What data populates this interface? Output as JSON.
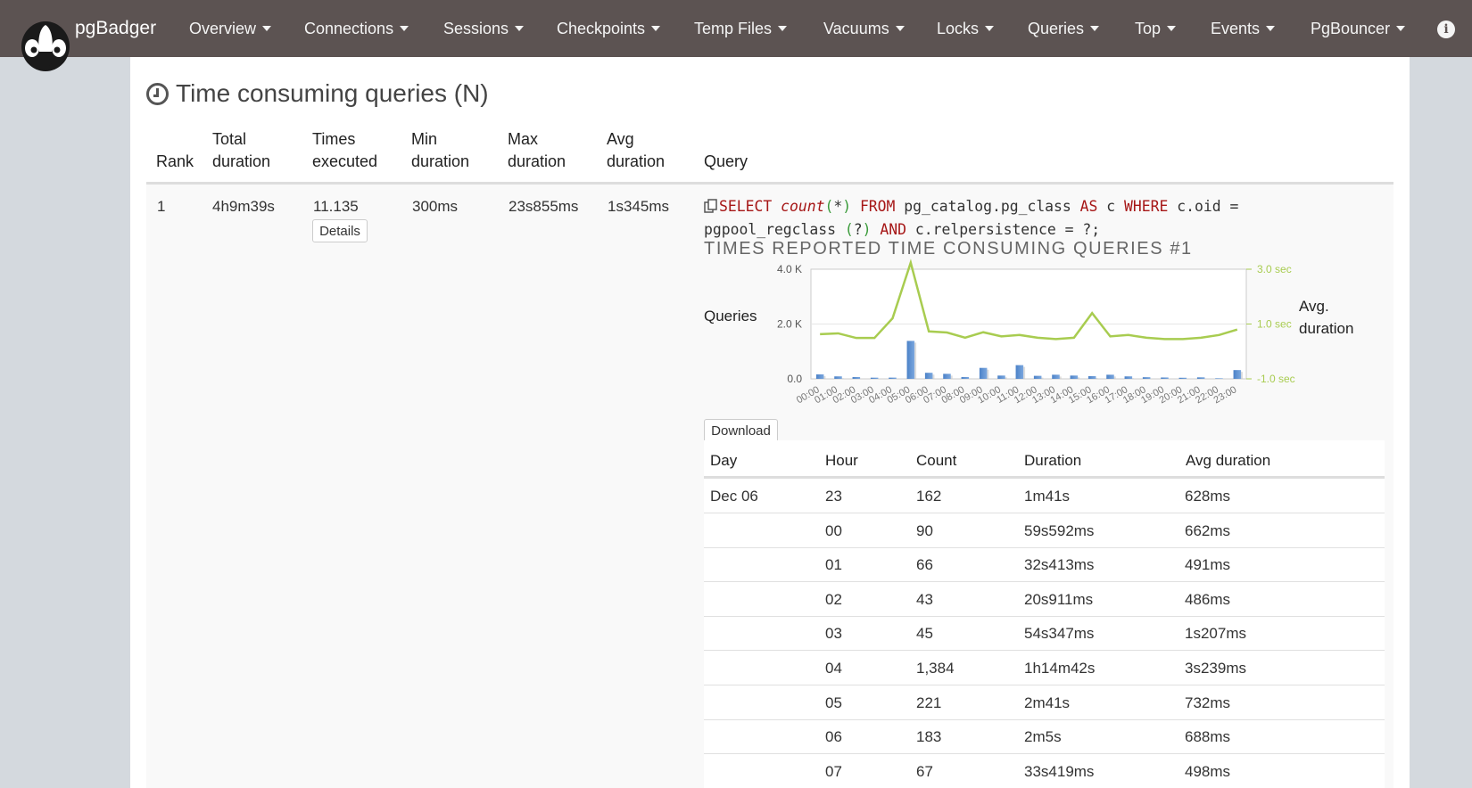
{
  "app": {
    "brand": "pgBadger",
    "nav": [
      "Overview",
      "Connections",
      "Sessions",
      "Checkpoints",
      "Temp Files",
      "Vacuums",
      "Locks",
      "Queries",
      "Top",
      "Events",
      "PgBouncer"
    ]
  },
  "section": {
    "title": "Time consuming queries (N)"
  },
  "table": {
    "headers": {
      "rank": "Rank",
      "total_1": "Total",
      "total_2": "duration",
      "times_1": "Times",
      "times_2": "executed",
      "min_1": "Min",
      "min_2": "duration",
      "max_1": "Max",
      "max_2": "duration",
      "avg_1": "Avg",
      "avg_2": "duration",
      "query": "Query"
    },
    "row": {
      "rank": "1",
      "total_duration": "4h9m39s",
      "times_executed": "11.135",
      "details_label": "Details",
      "min_duration": "300ms",
      "max_duration": "23s855ms",
      "avg_duration": "1s345ms"
    }
  },
  "query": {
    "t1": "SELECT",
    "t2": "count",
    "t3": "(",
    "t4": "*",
    "t5": ")",
    "t6": "FROM",
    "t7": "pg_catalog.pg_class",
    "t8": "AS",
    "t9": "c",
    "t10": "WHERE",
    "t11": "c.oid =",
    "t12": "pgpool_regclass",
    "t13": "(",
    "t14": "?",
    "t15": ")",
    "t16": "AND",
    "t17": "c.relpersistence = ?;"
  },
  "chart": {
    "title": "TIMES REPORTED TIME CONSUMING QUERIES #1",
    "download_label": "Download"
  },
  "chart_data": {
    "type": "bar",
    "title": "TIMES REPORTED TIME CONSUMING QUERIES #1",
    "ylabel": "Queries",
    "y2label_1": "Avg.",
    "y2label_2": "duration",
    "ylim": [
      0,
      4000
    ],
    "y2lim": [
      -1.0,
      3.0
    ],
    "y_ticks": [
      "4.0 K",
      "2.0 K",
      "0.0"
    ],
    "y2_ticks": [
      "3.0 sec",
      "1.0 sec",
      "-1.0 sec"
    ],
    "categories": [
      "00:00",
      "01:00",
      "02:00",
      "03:00",
      "04:00",
      "05:00",
      "06:00",
      "07:00",
      "08:00",
      "09:00",
      "10:00",
      "11:00",
      "12:00",
      "13:00",
      "14:00",
      "15:00",
      "16:00",
      "17:00",
      "18:00",
      "19:00",
      "20:00",
      "21:00",
      "22:00",
      "23:00"
    ],
    "series": [
      {
        "type": "bar",
        "values": [
          162,
          90,
          66,
          43,
          45,
          1384,
          221,
          183,
          67,
          400,
          120,
          500,
          110,
          150,
          120,
          100,
          150,
          90,
          60,
          50,
          40,
          55,
          20,
          320
        ]
      },
      {
        "type": "line",
        "values": [
          0.63,
          0.66,
          0.49,
          0.49,
          1.21,
          3.24,
          0.73,
          0.69,
          0.5,
          0.7,
          0.55,
          0.6,
          0.5,
          0.45,
          0.5,
          1.4,
          0.55,
          0.6,
          0.5,
          0.45,
          0.45,
          0.5,
          0.6,
          0.8
        ]
      }
    ],
    "line_color": "#a8cc50",
    "bar_color": "#5b8fd0",
    "grid": true
  },
  "detail": {
    "headers": [
      "Day",
      "Hour",
      "Count",
      "Duration",
      "Avg duration"
    ],
    "rows": [
      [
        "Dec 06",
        "23",
        "162",
        "1m41s",
        "628ms"
      ],
      [
        "",
        "00",
        "90",
        "59s592ms",
        "662ms"
      ],
      [
        "",
        "01",
        "66",
        "32s413ms",
        "491ms"
      ],
      [
        "",
        "02",
        "43",
        "20s911ms",
        "486ms"
      ],
      [
        "",
        "03",
        "45",
        "54s347ms",
        "1s207ms"
      ],
      [
        "",
        "04",
        "1,384",
        "1h14m42s",
        "3s239ms"
      ],
      [
        "",
        "05",
        "221",
        "2m41s",
        "732ms"
      ],
      [
        "",
        "06",
        "183",
        "2m5s",
        "688ms"
      ],
      [
        "",
        "07",
        "67",
        "33s419ms",
        "498ms"
      ]
    ]
  }
}
